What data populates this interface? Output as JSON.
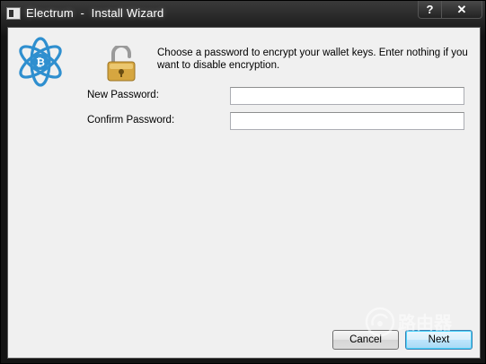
{
  "window": {
    "title": "Electrum  -  Install Wizard",
    "help_label": "?",
    "close_label": "✕"
  },
  "wizard": {
    "message": "Choose a password to encrypt your wallet keys.  Enter nothing if you want to disable encryption.",
    "new_password_label": "New Password:",
    "new_password_value": "",
    "confirm_password_label": "Confirm Password:",
    "confirm_password_value": ""
  },
  "buttons": {
    "cancel": "Cancel",
    "next": "Next"
  },
  "icons": {
    "app": "electrum-window-icon",
    "logo": "electrum-bitcoin-atom-logo",
    "lock": "open-padlock-icon"
  },
  "watermark": {
    "text": "路由器"
  },
  "colors": {
    "logo_blue": "#2f8fcf",
    "lock_gold": "#d6a640",
    "client_bg": "#f0f0f0"
  }
}
